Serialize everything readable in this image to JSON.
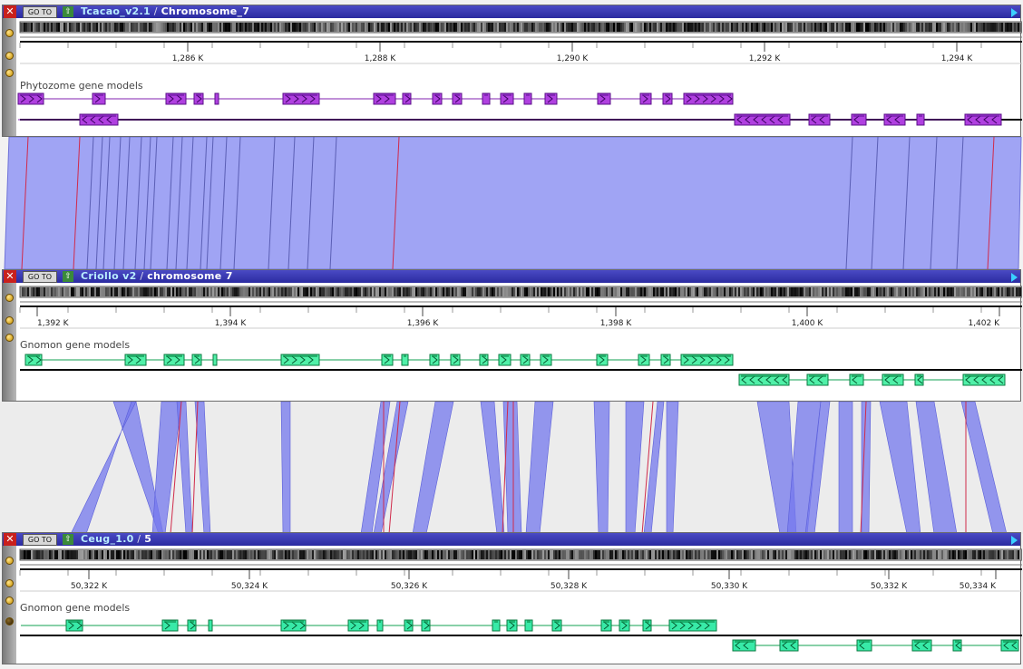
{
  "panels": [
    {
      "name": "Tcacao_v2.1",
      "chrom": "Chromosome_7",
      "goto_label": "GO TO",
      "track_label": "Phytozome gene models",
      "ticks": [
        "1,286 K",
        "1,288 K",
        "1,290 K",
        "1,292 K",
        "1,294 K"
      ],
      "color": "#b040e0"
    },
    {
      "name": "Criollo v2",
      "chrom": "chromosome 7",
      "goto_label": "GO TO",
      "track_label": "Gnomon gene models",
      "ticks": [
        "1,392 K",
        "1,394 K",
        "1,396 K",
        "1,398 K",
        "1,400 K",
        "1,402 K"
      ],
      "color": "#50f0a8"
    },
    {
      "name": "Ceug_1.0",
      "chrom": "5",
      "goto_label": "GO TO",
      "track_label": "Gnomon gene models",
      "ticks": [
        "50,322 K",
        "50,324 K",
        "50,326 K",
        "50,328 K",
        "50,330 K",
        "50,332 K",
        "50,334 K"
      ],
      "color": "#38eaa8"
    }
  ],
  "close_label": "✕",
  "up_label": "⇧"
}
